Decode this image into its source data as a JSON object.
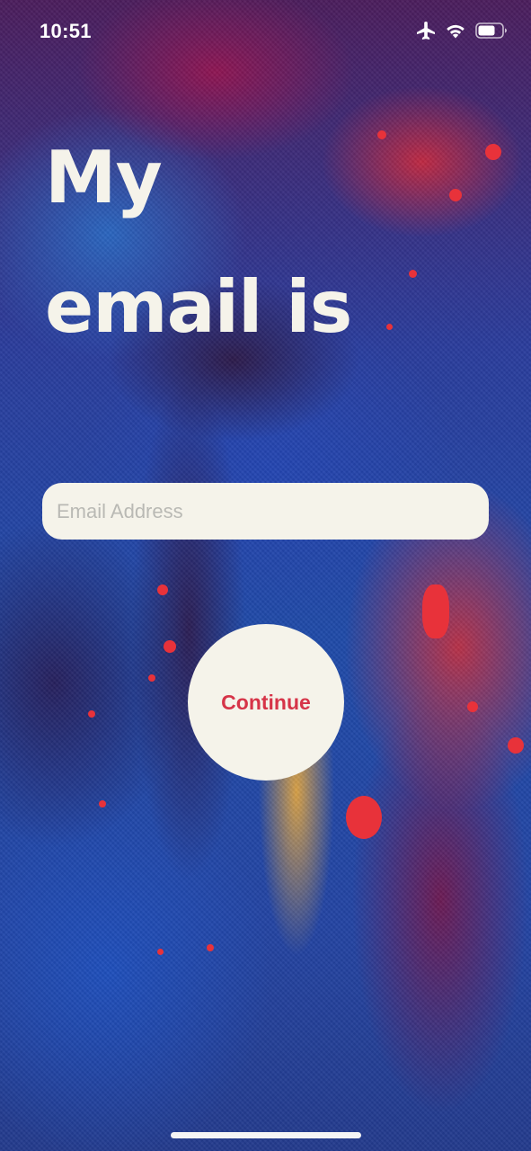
{
  "status_bar": {
    "time": "10:51",
    "icons": [
      "airplane-icon",
      "wifi-icon",
      "battery-icon"
    ]
  },
  "title": {
    "line1": "My",
    "line2": "email is"
  },
  "email_input": {
    "placeholder": "Email Address",
    "value": ""
  },
  "continue_button": {
    "label": "Continue"
  },
  "colors": {
    "card": "#f5f3ea",
    "accent": "#d63448",
    "title_text": "#f5f3ea"
  }
}
